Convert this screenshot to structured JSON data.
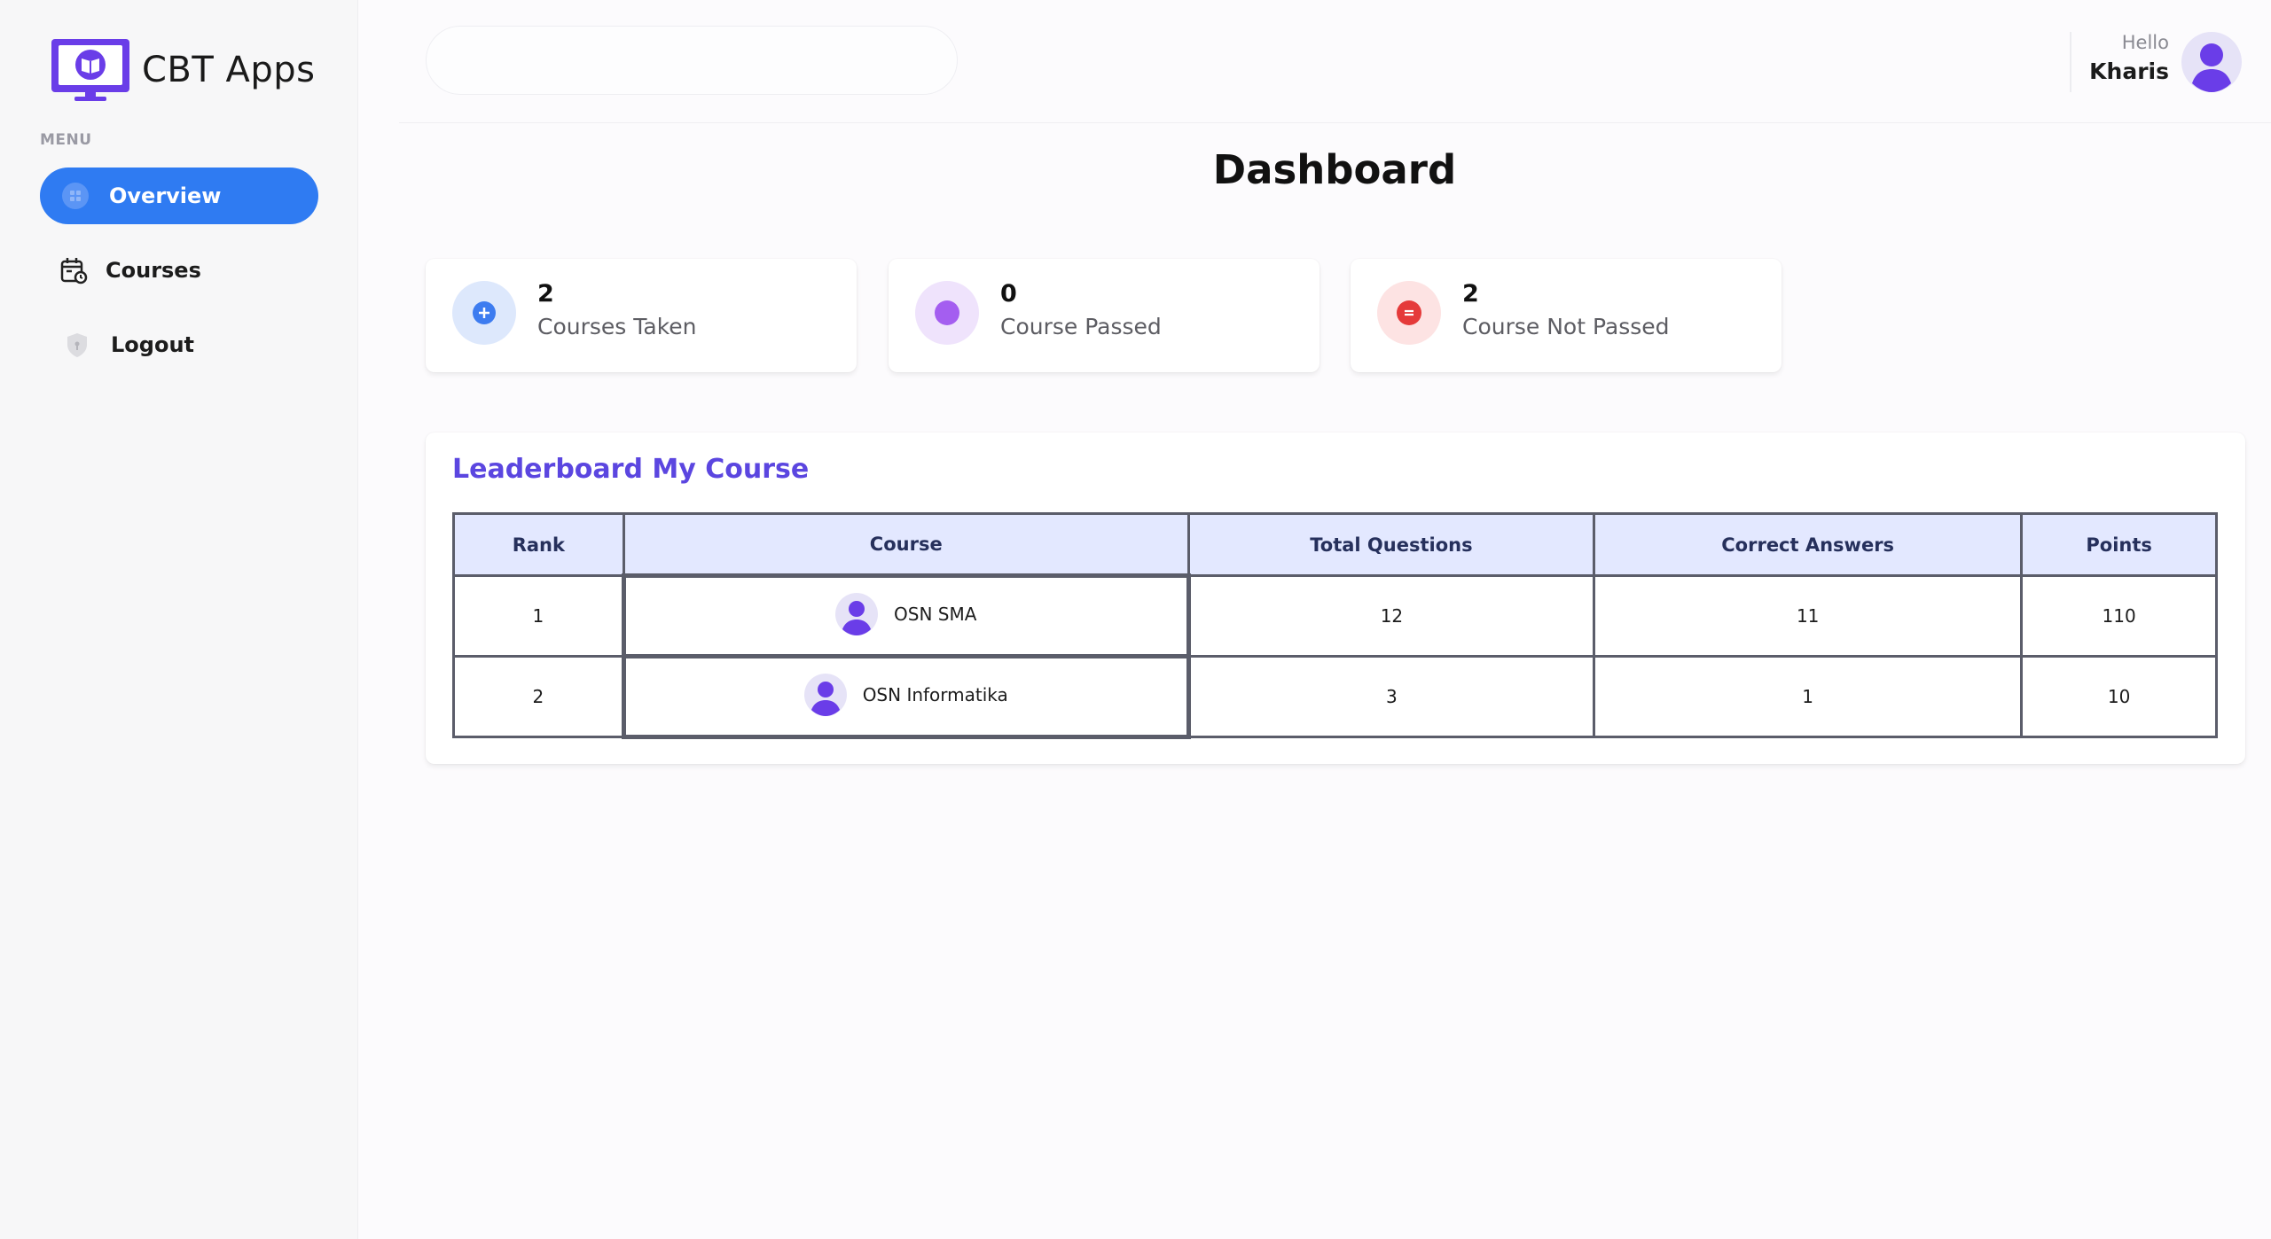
{
  "brand": {
    "name": "CBT Apps",
    "logo_icon": "monitor-book-icon"
  },
  "sidebar": {
    "menu_label": "MENU",
    "items": [
      {
        "label": "Overview",
        "icon": "grid-icon",
        "active": true
      },
      {
        "label": "Courses",
        "icon": "calendar-icon",
        "active": false
      },
      {
        "label": "Logout",
        "icon": "shield-icon",
        "active": false
      }
    ]
  },
  "header": {
    "search": {
      "placeholder": "",
      "value": ""
    },
    "greeting": "Hello",
    "user_name": "Kharis"
  },
  "page": {
    "title": "Dashboard"
  },
  "stats": [
    {
      "value": "2",
      "label": "Courses Taken",
      "icon": "plus-circle-icon",
      "color": "#3d7cf0"
    },
    {
      "value": "0",
      "label": "Course Passed",
      "icon": "dot-icon",
      "color": "#a45ef0"
    },
    {
      "value": "2",
      "label": "Course Not Passed",
      "icon": "minus-circle-icon",
      "color": "#e53a3a"
    }
  ],
  "leaderboard": {
    "title": "Leaderboard My Course",
    "columns": [
      "Rank",
      "Course",
      "Total Questions",
      "Correct Answers",
      "Points"
    ],
    "rows": [
      {
        "rank": "1",
        "course": "OSN SMA",
        "total_questions": "12",
        "correct_answers": "11",
        "points": "110"
      },
      {
        "rank": "2",
        "course": "OSN Informatika",
        "total_questions": "3",
        "correct_answers": "1",
        "points": "10"
      }
    ]
  },
  "colors": {
    "accent": "#2f7bf2",
    "title_purple": "#5b46e0",
    "avatar_purple": "#6a3de8"
  }
}
